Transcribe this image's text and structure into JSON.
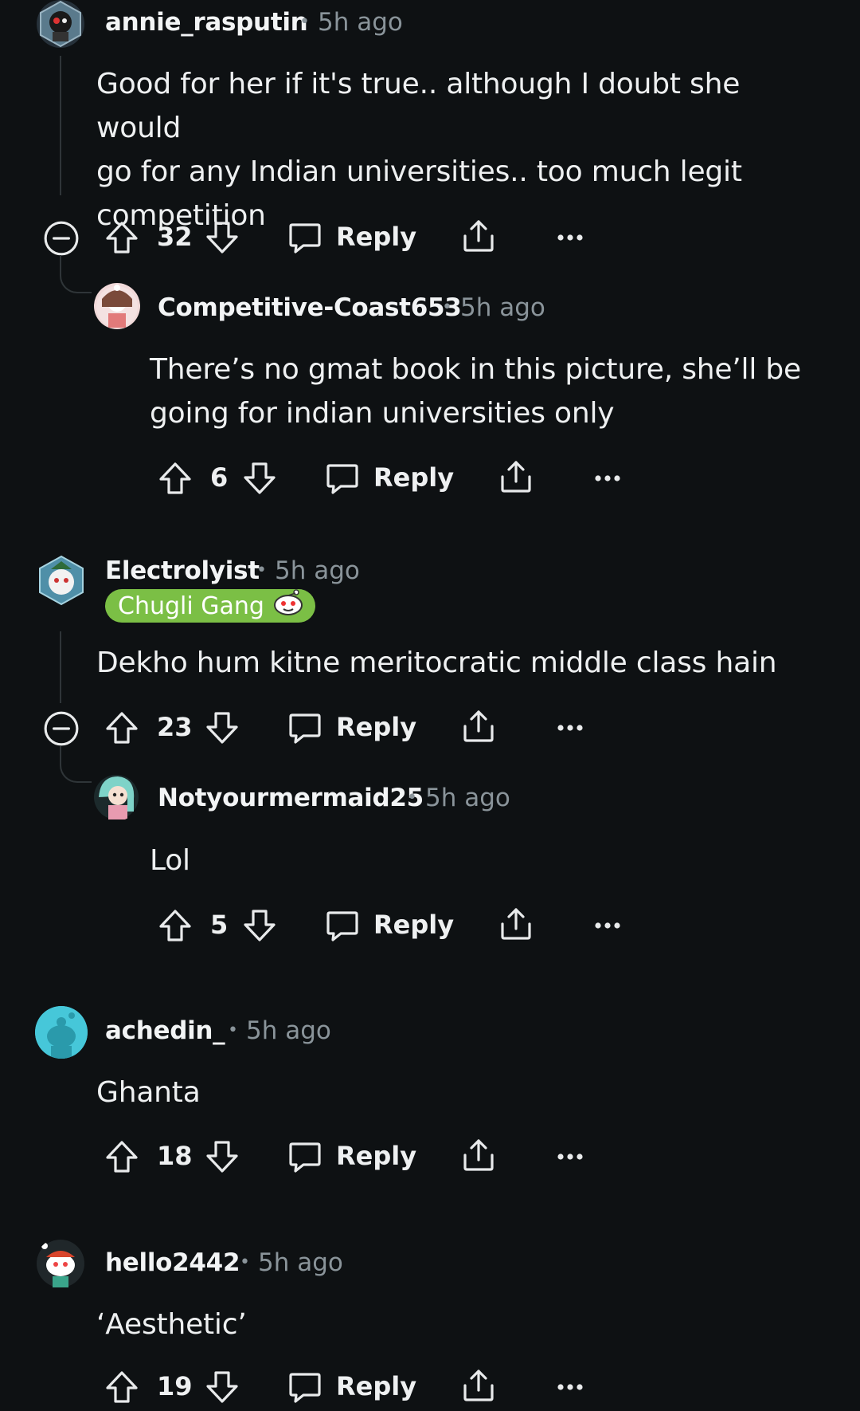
{
  "comments": [
    {
      "username": "annie_rasputin",
      "time": "5h ago",
      "lines": [
        "Good for her if it's true.. although I doubt she would",
        "go for any Indian universities.. too much legit",
        "competition"
      ],
      "votes": "32",
      "reply_label": "Reply"
    },
    {
      "username": "Competitive-Coast653",
      "time": "5h ago",
      "lines": [
        "There’s no gmat book in this picture, she’ll be",
        "going for indian universities only"
      ],
      "votes": "6",
      "reply_label": "Reply"
    },
    {
      "username": "Electrolyist",
      "time": "5h ago",
      "flair": "Chugli Gang",
      "lines": [
        "Dekho hum kitne meritocratic middle class hain"
      ],
      "votes": "23",
      "reply_label": "Reply"
    },
    {
      "username": "Notyourmermaid25",
      "time": "5h ago",
      "lines": [
        "Lol"
      ],
      "votes": "5",
      "reply_label": "Reply"
    },
    {
      "username": "achedin_",
      "time": "5h ago",
      "lines": [
        "Ghanta"
      ],
      "votes": "18",
      "reply_label": "Reply"
    },
    {
      "username": "hello2442",
      "time": "5h ago",
      "lines": [
        "‘Aesthetic’"
      ],
      "votes": "19",
      "reply_label": "Reply"
    }
  ],
  "icons": {
    "upvote": "arrow-up-icon",
    "downvote": "arrow-down-icon",
    "reply": "speech-bubble-icon",
    "share": "share-icon",
    "more": "more-dots-icon",
    "collapse": "collapse-minus-icon"
  },
  "colors": {
    "background": "#0e1113",
    "text": "#eef0f1",
    "muted": "#8a949a",
    "flair": "#7bbf45",
    "thread_line": "#2f3538"
  }
}
